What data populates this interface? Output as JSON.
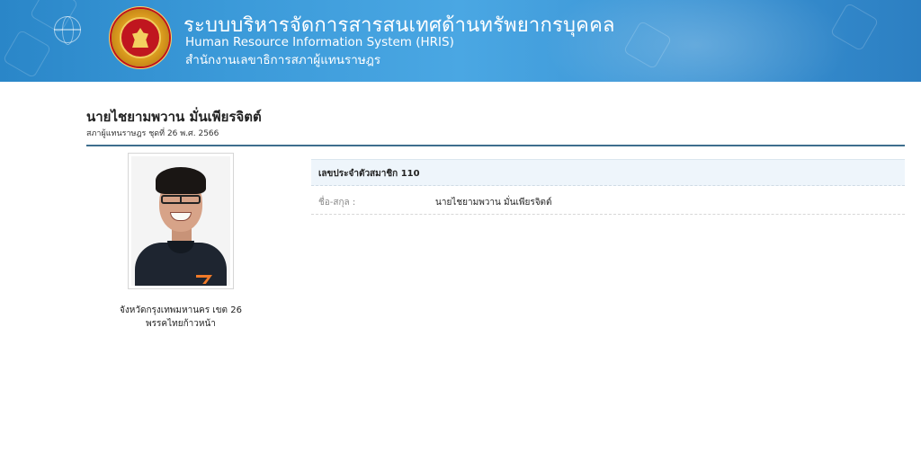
{
  "header": {
    "title_th": "ระบบบริหารจัดการสารสนเทศด้านทรัพยากรบุคคล",
    "title_en": "Human Resource Information System (HRIS)",
    "org_th": "สำนักงานเลขาธิการสภาผู้แทนราษฎร",
    "emblem_icon": "parliament-emblem-icon",
    "globe_icon": "globe-icon",
    "banner_color": "#3b9ad9"
  },
  "person": {
    "name": "นายไชยามพวาน  มั่นเพียรจิตต์",
    "subtitle": "สภาผู้แทนราษฎร ชุดที่ 26 พ.ศ. 2566",
    "caption_line1": "จังหวัดกรุงเทพมหานคร เขต 26",
    "caption_line2": "พรรคไทยก้าวหน้า"
  },
  "info": {
    "header": "เลขประจำตัวสมาชิก 110",
    "rows": [
      {
        "label": "ชื่อ-สกุล :",
        "value": "นายไชยามพวาน  มั่นเพียรจิตต์"
      }
    ]
  },
  "colors": {
    "divider": "#3e6e8e",
    "table_head_bg": "#eef5fb"
  }
}
